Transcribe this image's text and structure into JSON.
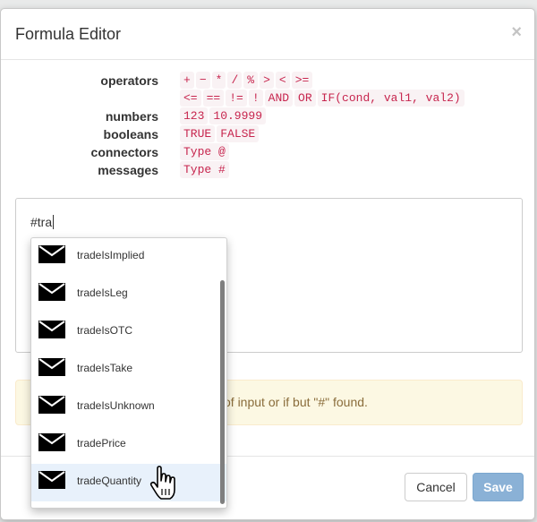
{
  "dialog": {
    "title": "Formula Editor",
    "close_glyph": "×"
  },
  "legend": {
    "operators_label": "operators",
    "operators_line1": [
      "+",
      "−",
      "*",
      "/",
      "%",
      ">",
      "<",
      ">="
    ],
    "operators_line2": [
      "<=",
      "==",
      "!=",
      "!",
      "AND",
      "OR",
      "IF(cond, val1, val2)"
    ],
    "numbers_label": "numbers",
    "numbers": [
      "123",
      "10.9999"
    ],
    "booleans_label": "booleans",
    "booleans": [
      "TRUE",
      "FALSE"
    ],
    "connectors_label": "connectors",
    "connectors": [
      "Type @"
    ],
    "messages_label": "messages",
    "messages": [
      "Type #"
    ]
  },
  "editor": {
    "value": "#tra"
  },
  "alert": {
    "visible_text": "of input or if but \"#\" found."
  },
  "autocomplete": {
    "items": [
      {
        "label": "tradeIsImplied",
        "icon": "envelope-icon",
        "active": false
      },
      {
        "label": "tradeIsLeg",
        "icon": "envelope-icon",
        "active": false
      },
      {
        "label": "tradeIsOTC",
        "icon": "envelope-icon",
        "active": false
      },
      {
        "label": "tradeIsTake",
        "icon": "envelope-icon",
        "active": false
      },
      {
        "label": "tradeIsUnknown",
        "icon": "envelope-icon",
        "active": false
      },
      {
        "label": "tradePrice",
        "icon": "envelope-icon",
        "active": false
      },
      {
        "label": "tradeQuantity",
        "icon": "envelope-icon",
        "active": true
      }
    ]
  },
  "footer": {
    "cancel_label": "Cancel",
    "save_label": "Save"
  },
  "colors": {
    "code_text": "#c7254e",
    "code_bg": "#f9f2f4",
    "alert_bg": "#fcf8e3",
    "alert_text": "#8a6d3b",
    "save_bg": "#8ab1d6",
    "active_item_bg": "#e8f1fb"
  }
}
